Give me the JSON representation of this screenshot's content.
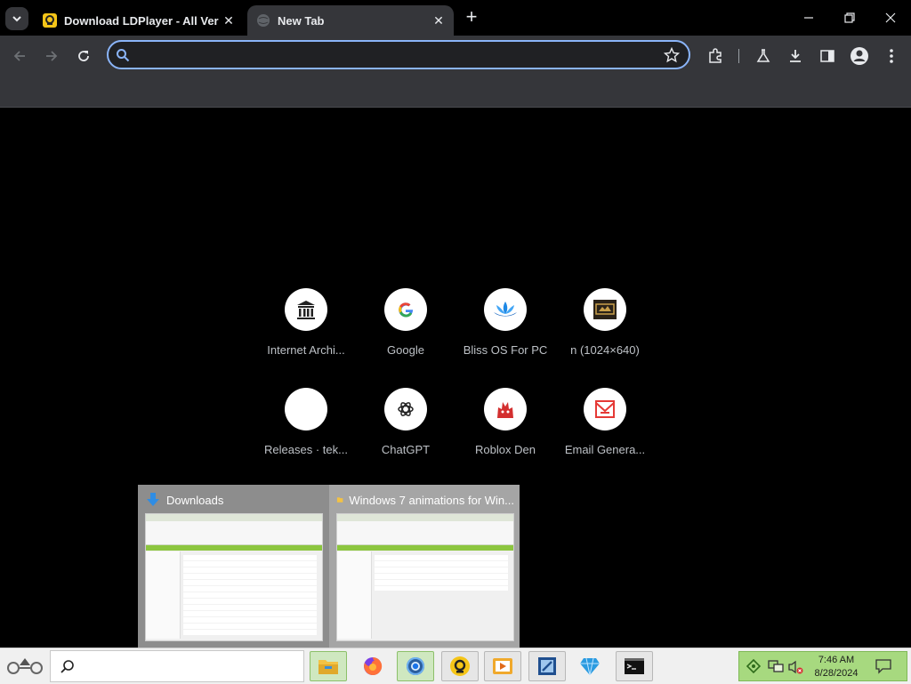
{
  "tabs": [
    {
      "title": "Download LDPlayer - All Versio",
      "active": false
    },
    {
      "title": "New Tab",
      "active": true
    }
  ],
  "omnibox": {
    "value": "",
    "placeholder": ""
  },
  "shortcuts": [
    {
      "label": "Internet Archi...",
      "icon": "archive-icon"
    },
    {
      "label": "Google",
      "icon": "google-icon"
    },
    {
      "label": "Bliss OS For PC",
      "icon": "lotus-icon"
    },
    {
      "label": "n (1024×640)",
      "icon": "image-thumbnail-icon"
    },
    {
      "label": "Releases · tek...",
      "icon": "blank-icon"
    },
    {
      "label": "ChatGPT",
      "icon": "chatgpt-icon"
    },
    {
      "label": "Roblox Den",
      "icon": "roblox-den-icon"
    },
    {
      "label": "Email Genera...",
      "icon": "email-icon"
    }
  ],
  "preview": {
    "windows": [
      {
        "title": "Downloads",
        "icon": "download-arrow-icon"
      },
      {
        "title": "Windows 7 animations for Win...",
        "icon": "folder-icon"
      }
    ]
  },
  "taskbar": {
    "clock_time": "7:46 AM",
    "clock_date": "8/28/2024",
    "apps": [
      "file-explorer-icon",
      "firefox-icon",
      "chrome-icon",
      "ldplayer-icon",
      "media-player-icon",
      "remote-tool-icon",
      "diamond-app-icon",
      "terminal-icon"
    ]
  },
  "colors": {
    "accent": "#8ab4f8",
    "toolbar": "#35363a",
    "tray": "#a7d97f"
  }
}
